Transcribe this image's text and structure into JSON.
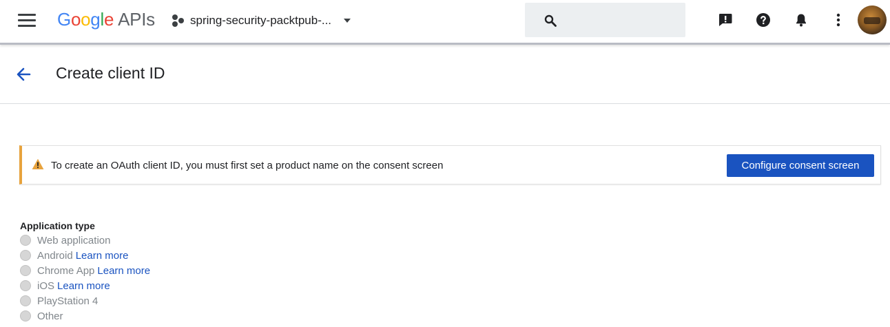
{
  "header": {
    "brand": {
      "letters": [
        "G",
        "o",
        "o",
        "g",
        "l",
        "e"
      ],
      "suffix": "APIs"
    },
    "project_name": "spring-security-packtpub-...",
    "icons": {
      "menu": "hamburger-menu-icon",
      "search": "search-icon",
      "feedback": "feedback-icon",
      "help": "help-icon",
      "notifications": "bell-icon",
      "more": "more-vert-icon"
    }
  },
  "page": {
    "title": "Create client ID",
    "back_icon": "arrow-back-icon"
  },
  "banner": {
    "icon": "warning-icon",
    "message": "To create an OAuth client ID, you must first set a product name on the consent screen",
    "button_label": "Configure consent screen",
    "accent_color": "#e8a33d",
    "button_color": "#1a53c0"
  },
  "app_type": {
    "label": "Application type",
    "options": [
      {
        "label": "Web application",
        "link": ""
      },
      {
        "label": "Android",
        "link": "Learn more"
      },
      {
        "label": "Chrome App",
        "link": "Learn more"
      },
      {
        "label": "iOS",
        "link": "Learn more"
      },
      {
        "label": "PlayStation 4",
        "link": ""
      },
      {
        "label": "Other",
        "link": ""
      }
    ]
  }
}
